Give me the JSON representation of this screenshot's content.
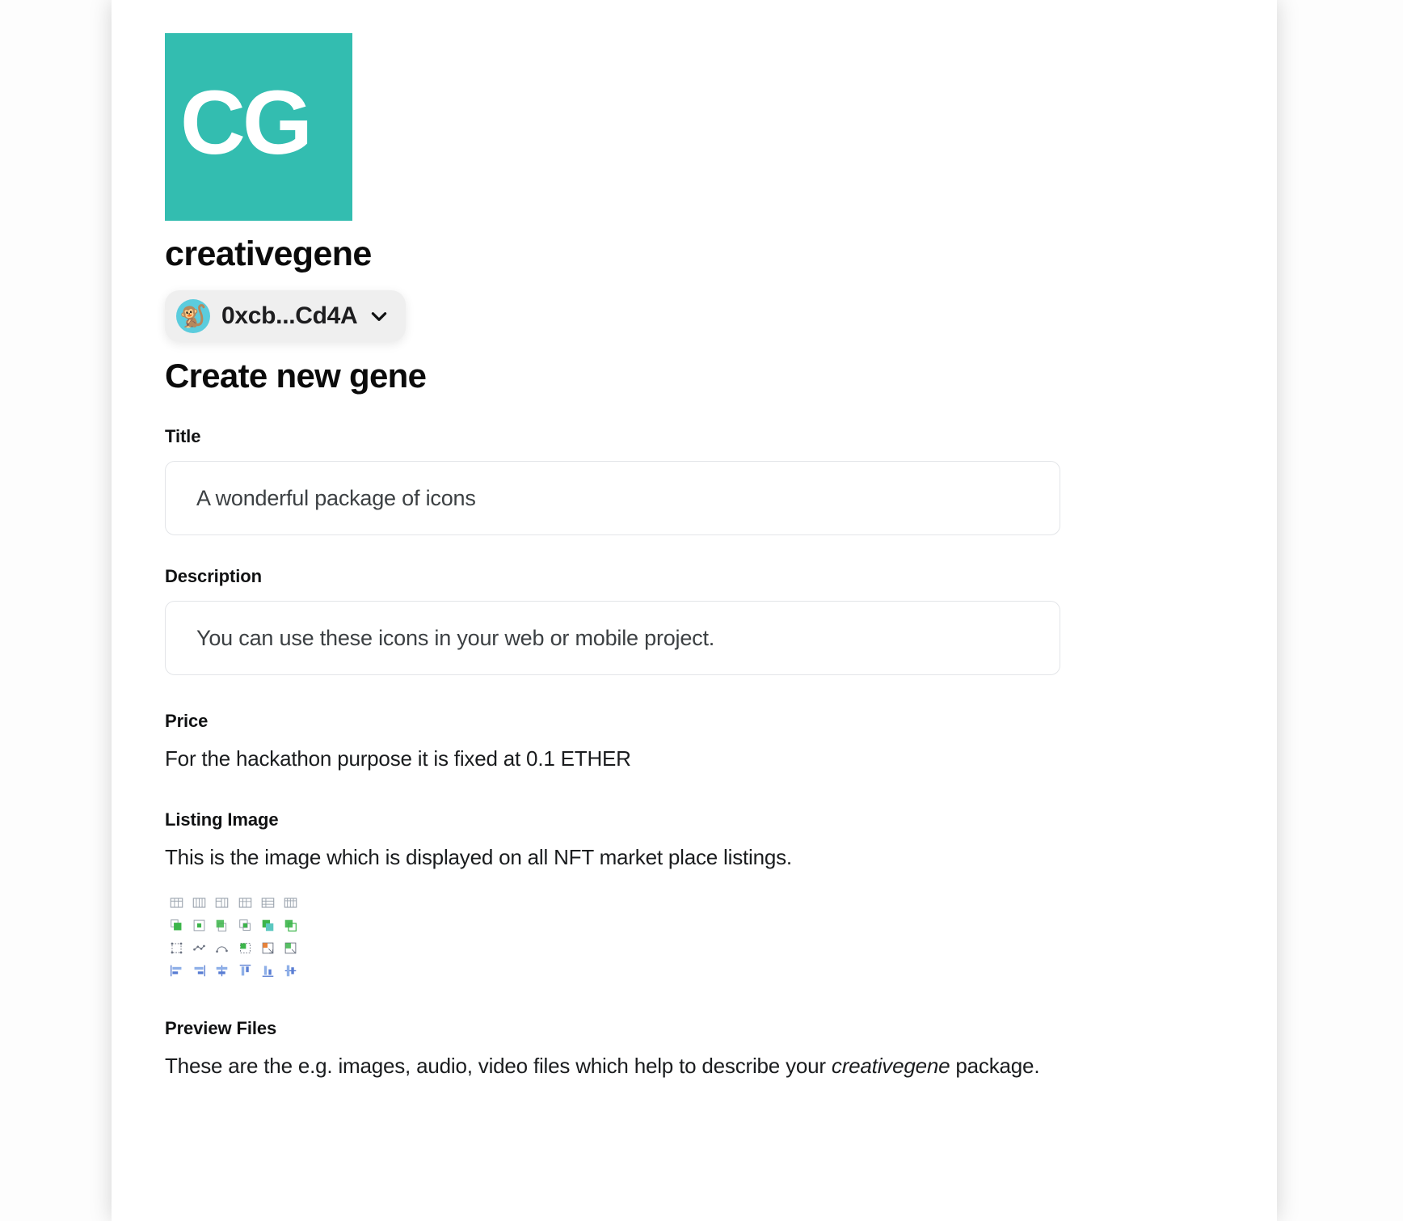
{
  "brand": {
    "logo_text": "CG",
    "logo_color": "#33bdb0",
    "name": "creativegene"
  },
  "wallet": {
    "avatar_icon": "monkey-emoji",
    "avatar_glyph": "🐒",
    "address": "0xcb...Cd4A",
    "chevron_icon": "chevron-down-icon"
  },
  "page": {
    "title": "Create new gene"
  },
  "form": {
    "title_field": {
      "label": "Title",
      "value": "A wonderful package of icons",
      "placeholder": "A wonderful package of icons"
    },
    "description_field": {
      "label": "Description",
      "value": "You can use these icons in your web or mobile project.",
      "placeholder": "You can use these icons in your web or mobile project."
    }
  },
  "sections": {
    "price": {
      "title": "Price",
      "body": "For the hackathon purpose it is fixed at 0.1 ETHER"
    },
    "listing_image": {
      "title": "Listing Image",
      "body": "This is the image which is displayed on all NFT market place listings.",
      "thumbnail_name": "icon-pack-preview-thumbnail"
    },
    "preview_files": {
      "title": "Preview Files",
      "body_before": "These are the e.g. images, audio, video files which help to describe your ",
      "body_emphasis": "creativegene",
      "body_after": " package."
    }
  }
}
